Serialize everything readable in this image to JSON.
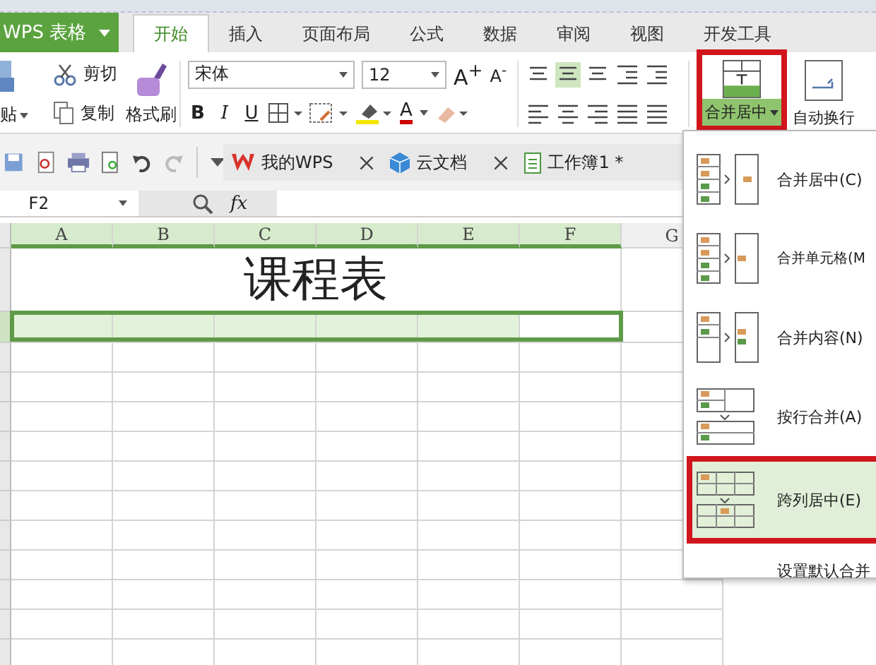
{
  "app_button": {
    "label": "WPS 表格"
  },
  "tabs": [
    {
      "label": "开始",
      "selected": true
    },
    {
      "label": "插入",
      "selected": false
    },
    {
      "label": "页面布局",
      "selected": false
    },
    {
      "label": "公式",
      "selected": false
    },
    {
      "label": "数据",
      "selected": false
    },
    {
      "label": "审阅",
      "selected": false
    },
    {
      "label": "视图",
      "selected": false
    },
    {
      "label": "开发工具",
      "selected": false
    }
  ],
  "clipboard": {
    "paste": "贴",
    "cut": "剪切",
    "copy": "复制",
    "format_painter": "格式刷"
  },
  "font": {
    "family": "宋体",
    "size": "12",
    "grow": "A$^{+}$",
    "shrink": "A$^{-}$",
    "styles": [
      "B",
      "I",
      "U"
    ],
    "color_letter": "A"
  },
  "merge_button": {
    "label": "合并居中"
  },
  "wrap_button": {
    "label": "自动换行"
  },
  "doc_tabs": [
    {
      "label": "我的WPS",
      "kind": "wps",
      "closable": true
    },
    {
      "label": "云文档",
      "kind": "cloud",
      "closable": true
    },
    {
      "label": "工作簿1 *",
      "kind": "sheet",
      "closable": false
    }
  ],
  "formula_bar": {
    "name_box": "F2",
    "fx": "fx"
  },
  "sheet": {
    "title": "课程表",
    "columns": [
      {
        "label": "A",
        "selected": true,
        "active": false
      },
      {
        "label": "B",
        "selected": true,
        "active": false
      },
      {
        "label": "C",
        "selected": true,
        "active": false
      },
      {
        "label": "D",
        "selected": true,
        "active": false
      },
      {
        "label": "E",
        "selected": true,
        "active": false
      },
      {
        "label": "F",
        "selected": true,
        "active": true
      },
      {
        "label": "G",
        "selected": false,
        "active": false
      }
    ]
  },
  "merge_menu": {
    "items": [
      {
        "label": "合并居中(C)",
        "kind": "merge-center",
        "selected": false
      },
      {
        "label": "合并单元格(M",
        "kind": "merge-cells",
        "selected": false
      },
      {
        "label": "合并内容(N)",
        "kind": "merge-content",
        "selected": false
      },
      {
        "label": "按行合并(A)",
        "kind": "merge-rows",
        "selected": false
      },
      {
        "label": "跨列居中(E)",
        "kind": "center-across",
        "selected": true
      }
    ],
    "footer": "设置默认合并"
  }
}
